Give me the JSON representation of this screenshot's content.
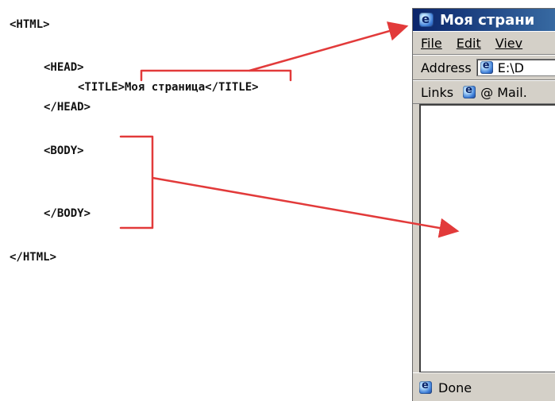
{
  "code_lines": {
    "html_open": "<HTML>",
    "head_open": "<HEAD>",
    "title_line": "<TITLE>Моя страница</TITLE>",
    "head_close": "</HEAD>",
    "body_open": "<BODY>",
    "body_close": "</BODY>",
    "html_close": "</HTML>"
  },
  "browser": {
    "title": "Моя страни",
    "menu": {
      "file": "File",
      "edit": "Edit",
      "view": "Viev"
    },
    "address_label": "Address",
    "address_value": "E:\\D",
    "links_label": "Links",
    "links_item": "@ Mail.",
    "status": "Done"
  },
  "colors": {
    "accent_red": "#e23a3a",
    "titlebar_blue": "#0a246a",
    "chrome_gray": "#d4d0c8"
  },
  "icons": {
    "browser_title": "ie-icon",
    "address": "ie-icon",
    "links": "ie-icon",
    "status": "ie-icon"
  }
}
